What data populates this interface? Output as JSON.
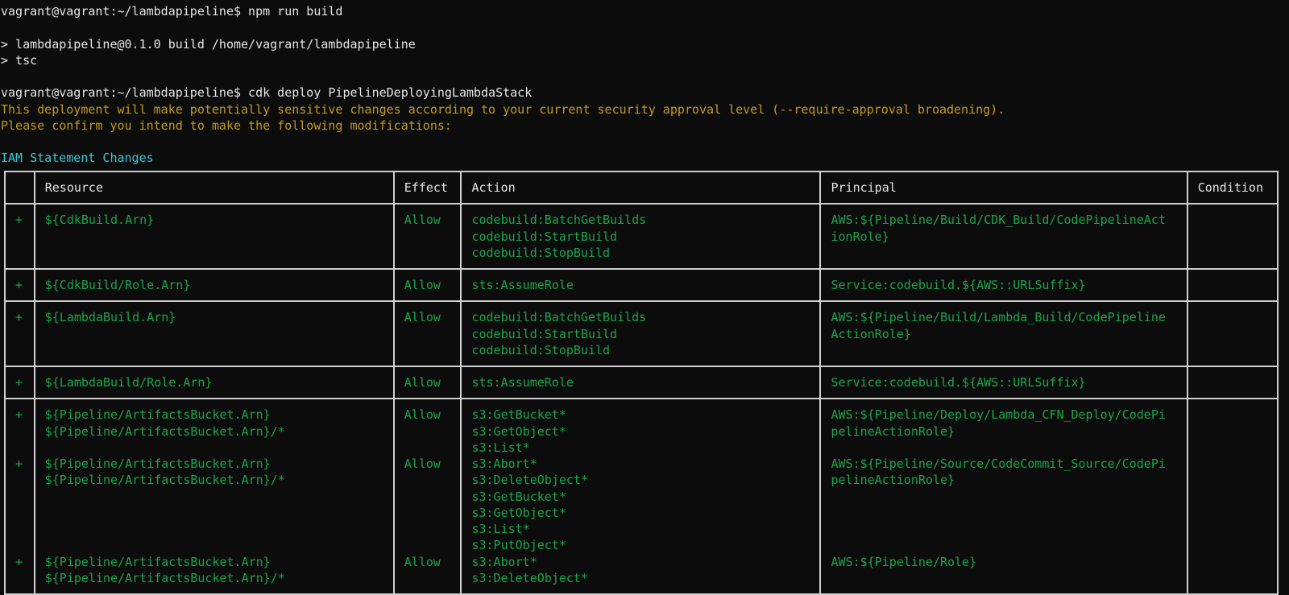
{
  "terminal": {
    "lines": [
      {
        "text": "vagrant@vagrant:~/lambdapipeline$ npm run build",
        "color": "white"
      },
      {
        "text": "",
        "color": "white"
      },
      {
        "text": "> lambdapipeline@0.1.0 build /home/vagrant/lambdapipeline",
        "color": "white"
      },
      {
        "text": "> tsc",
        "color": "white"
      },
      {
        "text": "",
        "color": "white"
      },
      {
        "text": "vagrant@vagrant:~/lambdapipeline$ cdk deploy PipelineDeployingLambdaStack",
        "color": "white"
      },
      {
        "text": "This deployment will make potentially sensitive changes according to your current security approval level (--require-approval broadening).",
        "color": "yellow"
      },
      {
        "text": "Please confirm you intend to make the following modifications:",
        "color": "yellow"
      },
      {
        "text": "",
        "color": "white"
      },
      {
        "text": "IAM Statement Changes",
        "color": "cyan"
      }
    ]
  },
  "iam_table": {
    "headers": [
      "",
      "Resource",
      "Effect",
      "Action",
      "Principal",
      "Condition"
    ],
    "rows": [
      {
        "marker": "+",
        "resource": [
          "${CdkBuild.Arn}"
        ],
        "effect": "Allow",
        "action": [
          "codebuild:BatchGetBuilds",
          "codebuild:StartBuild",
          "codebuild:StopBuild"
        ],
        "principal": [
          "AWS:${Pipeline/Build/CDK_Build/CodePipelineAct",
          "ionRole}"
        ],
        "condition": ""
      },
      {
        "marker": "+",
        "resource": [
          "${CdkBuild/Role.Arn}"
        ],
        "effect": "Allow",
        "action": [
          "sts:AssumeRole"
        ],
        "principal": [
          "Service:codebuild.${AWS::URLSuffix}"
        ],
        "condition": ""
      },
      {
        "marker": "+",
        "resource": [
          "${LambdaBuild.Arn}"
        ],
        "effect": "Allow",
        "action": [
          "codebuild:BatchGetBuilds",
          "codebuild:StartBuild",
          "codebuild:StopBuild"
        ],
        "principal": [
          "AWS:${Pipeline/Build/Lambda_Build/CodePipeline",
          "ActionRole}"
        ],
        "condition": ""
      },
      {
        "marker": "+",
        "resource": [
          "${LambdaBuild/Role.Arn}"
        ],
        "effect": "Allow",
        "action": [
          "sts:AssumeRole"
        ],
        "principal": [
          "Service:codebuild.${AWS::URLSuffix}"
        ],
        "condition": ""
      }
    ],
    "group_row": {
      "entries": [
        {
          "marker": "+",
          "resource": [
            "${Pipeline/ArtifactsBucket.Arn}",
            "${Pipeline/ArtifactsBucket.Arn}/*"
          ],
          "effect": "Allow",
          "action": [
            "s3:GetBucket*",
            "s3:GetObject*",
            "s3:List*"
          ],
          "principal": [
            "AWS:${Pipeline/Deploy/Lambda_CFN_Deploy/CodePi",
            "pelineActionRole}"
          ]
        },
        {
          "marker": "+",
          "resource": [
            "${Pipeline/ArtifactsBucket.Arn}",
            "${Pipeline/ArtifactsBucket.Arn}/*"
          ],
          "effect": "Allow",
          "action": [
            "s3:Abort*",
            "s3:DeleteObject*",
            "s3:GetBucket*",
            "s3:GetObject*",
            "s3:List*",
            "s3:PutObject*"
          ],
          "principal": [
            "AWS:${Pipeline/Source/CodeCommit_Source/CodePi",
            "pelineActionRole}"
          ]
        },
        {
          "marker": "+",
          "resource": [
            "${Pipeline/ArtifactsBucket.Arn}",
            "${Pipeline/ArtifactsBucket.Arn}/*"
          ],
          "effect": "Allow",
          "action": [
            "s3:Abort*",
            "s3:DeleteObject*"
          ],
          "principal": [
            "AWS:${Pipeline/Role}"
          ]
        }
      ]
    }
  },
  "colors": {
    "background": "#0c0c0c",
    "foreground": "#e6e6e6",
    "yellow": "#c39a1c",
    "cyan": "#3ec8d8",
    "green": "#1aa64a",
    "border": "#cfcfcf"
  }
}
